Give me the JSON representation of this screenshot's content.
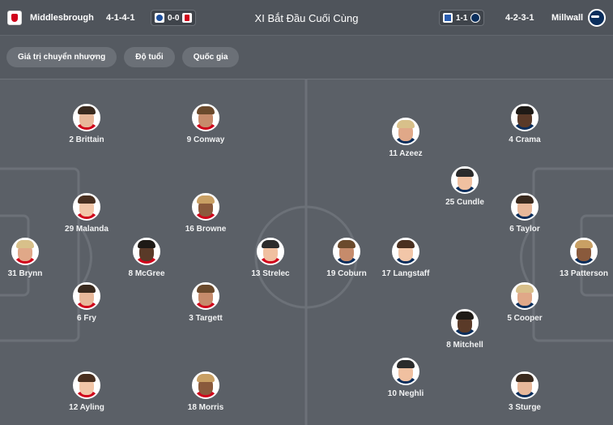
{
  "header": {
    "title": "XI Bắt Đầu Cuối Cùng",
    "home": {
      "name": "Middlesbrough",
      "formation": "4-1-4-1",
      "last_result": "0-0"
    },
    "away": {
      "name": "Millwall",
      "formation": "4-2-3-1",
      "last_result": "1-1"
    }
  },
  "tabs": [
    {
      "label": "Giá trị chuyển nhượng"
    },
    {
      "label": "Độ tuổi"
    },
    {
      "label": "Quốc gia"
    }
  ],
  "colors": {
    "home_shirt": "#d0021b",
    "away_shirt": "#0a2e5c"
  },
  "players": [
    {
      "label": "2 Brittain",
      "team": "home"
    },
    {
      "label": "9 Conway",
      "team": "home"
    },
    {
      "label": "29 Malanda",
      "team": "home"
    },
    {
      "label": "16 Browne",
      "team": "home"
    },
    {
      "label": "31 Brynn",
      "team": "home"
    },
    {
      "label": "8 McGree",
      "team": "home"
    },
    {
      "label": "13 Strelec",
      "team": "home"
    },
    {
      "label": "6 Fry",
      "team": "home"
    },
    {
      "label": "3 Targett",
      "team": "home"
    },
    {
      "label": "12 Ayling",
      "team": "home"
    },
    {
      "label": "18 Morris",
      "team": "home"
    },
    {
      "label": "11 Azeez",
      "team": "away"
    },
    {
      "label": "4 Crama",
      "team": "away"
    },
    {
      "label": "25 Cundle",
      "team": "away"
    },
    {
      "label": "6 Taylor",
      "team": "away"
    },
    {
      "label": "19 Coburn",
      "team": "away"
    },
    {
      "label": "17 Langstaff",
      "team": "away"
    },
    {
      "label": "13 Patterson",
      "team": "away"
    },
    {
      "label": "5 Cooper",
      "team": "away"
    },
    {
      "label": "8 Mitchell",
      "team": "away"
    },
    {
      "label": "10 Neghli",
      "team": "away"
    },
    {
      "label": "3 Sturge",
      "team": "away"
    }
  ]
}
